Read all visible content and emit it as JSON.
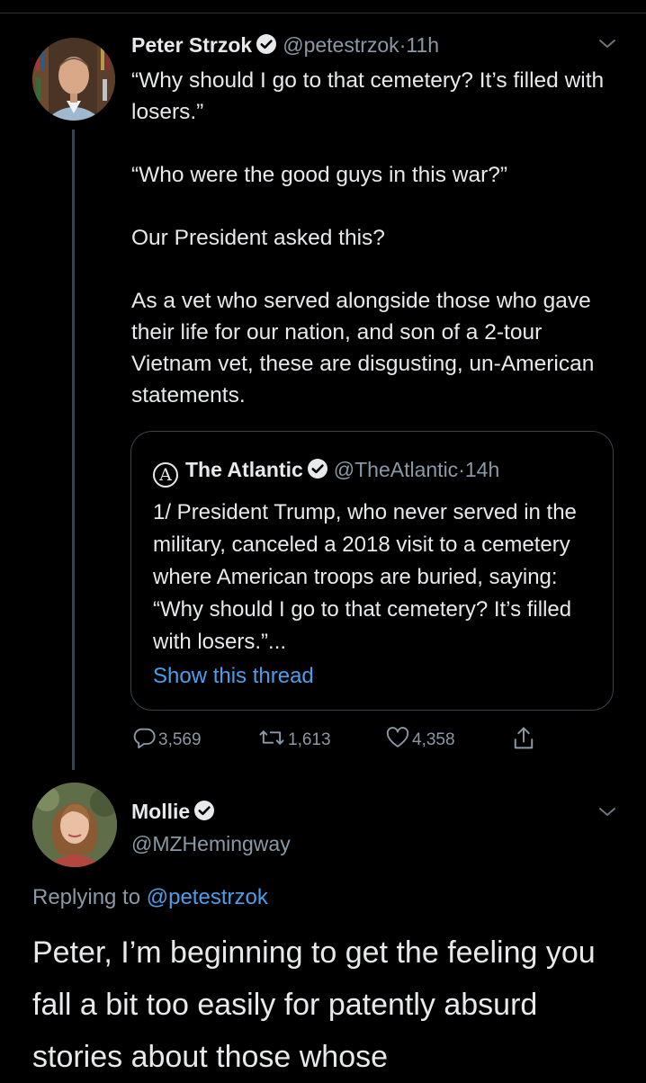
{
  "tweet": {
    "author_name": "Peter Strzok",
    "handle": "@petestrzok",
    "separator": "·",
    "time": "11h",
    "paragraphs": [
      "“Why should I go to that cemetery? It’s filled with losers.”",
      "“Who were the good guys in this war?”",
      "Our President asked this?",
      "As a vet who served alongside those who gave their life for our nation, and son of a 2-tour Vietnam vet, these are disgusting, un-American statements."
    ],
    "quote": {
      "logo_letter": "A",
      "author_name": "The Atlantic",
      "handle": "@TheAtlantic",
      "separator": "·",
      "time": "14h",
      "text": "1/ President Trump, who never served in the military, canceled a 2018 visit to a cemetery where American troops are buried, saying: “Why should I go to that cemetery? It’s filled with losers.”...",
      "show_thread": "Show this thread"
    },
    "actions": {
      "replies": "3,569",
      "retweets": "1,613",
      "likes": "4,358"
    }
  },
  "reply": {
    "author_name": "Mollie",
    "handle": "@MZHemingway",
    "replying_prefix": "Replying to",
    "replying_to": "@petestrzok",
    "text": "Peter, I’m beginning to get the feeling you fall a bit too easily for patently absurd stories about those whose"
  },
  "icons": {
    "verified": "verified-badge-icon",
    "more": "chevron-down-icon",
    "reply": "reply-icon",
    "retweet": "retweet-icon",
    "like": "heart-icon",
    "share": "share-icon"
  },
  "colors": {
    "background": "#000000",
    "text": "#e7e9ea",
    "secondary": "#8b98a5",
    "link": "#4d9eea",
    "border": "#38444d"
  }
}
